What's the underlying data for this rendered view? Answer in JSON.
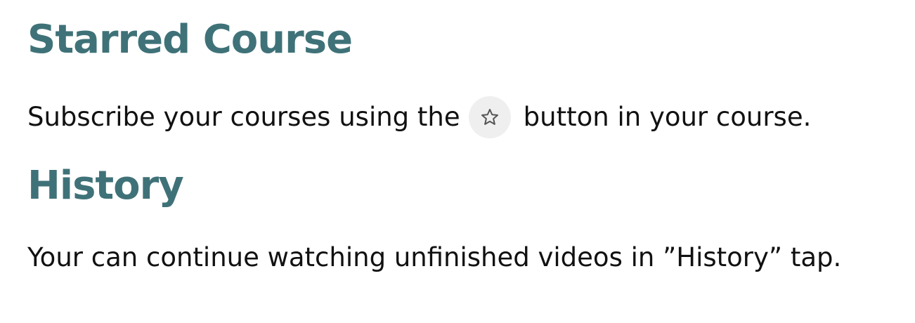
{
  "starred": {
    "title": "Starred Course",
    "text_before": "Subscribe your courses using the",
    "star_button_icon": "star-outline-icon",
    "text_after": "button in your course."
  },
  "history": {
    "title": "History",
    "text": "Your can continue watching unfinished videos in ”History” tap."
  },
  "colors": {
    "heading": "#3f7278",
    "body_text": "#111111",
    "button_bg": "#efefef",
    "icon": "#555555"
  }
}
